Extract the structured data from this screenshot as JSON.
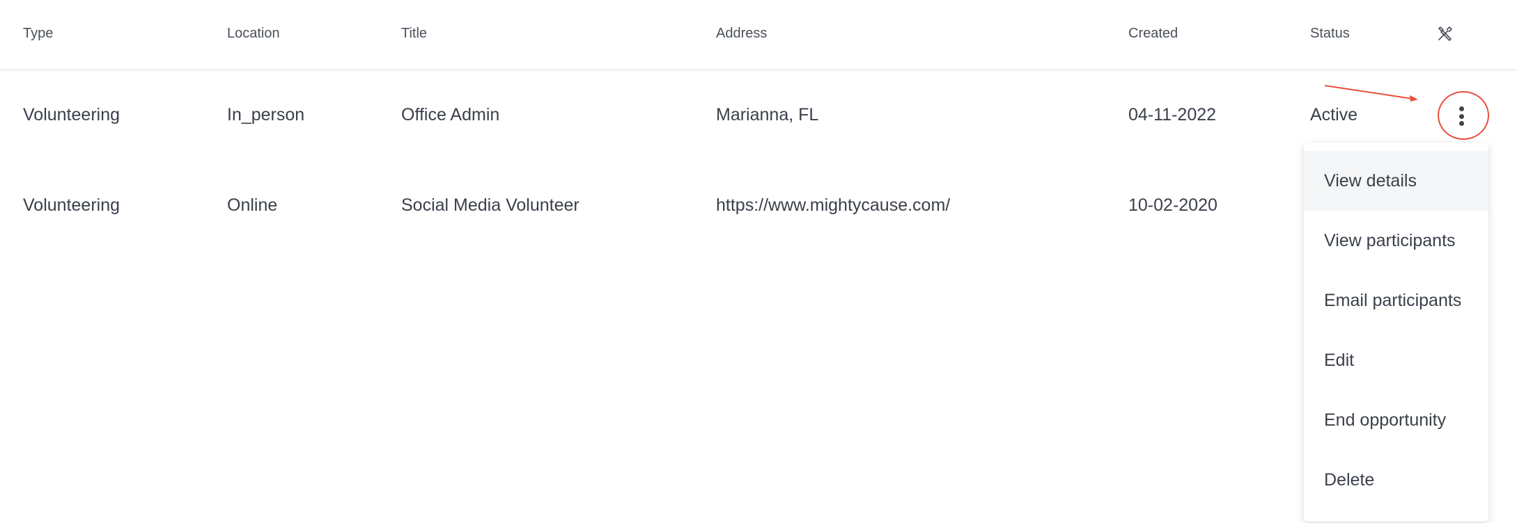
{
  "table": {
    "columns": {
      "type": "Type",
      "location": "Location",
      "title": "Title",
      "address": "Address",
      "created": "Created",
      "status": "Status"
    },
    "rows": [
      {
        "type": "Volunteering",
        "location": "In_person",
        "title": "Office Admin",
        "address": "Marianna, FL",
        "created": "04-11-2022",
        "status": "Active"
      },
      {
        "type": "Volunteering",
        "location": "Online",
        "title": "Social Media Volunteer",
        "address": "https://www.mightycause.com/",
        "created": "10-02-2020",
        "status": ""
      }
    ]
  },
  "icons": {
    "column_settings": "tools-icon",
    "row_actions": "kebab-menu-icon"
  },
  "menu": {
    "items": [
      "View details",
      "View participants",
      "Email participants",
      "Edit",
      "End opportunity",
      "Delete"
    ],
    "highlighted_item": "View details"
  },
  "colors": {
    "annotation": "#e8503a",
    "text": "#3a3f4a",
    "hover_bg": "#f5f6f7"
  }
}
